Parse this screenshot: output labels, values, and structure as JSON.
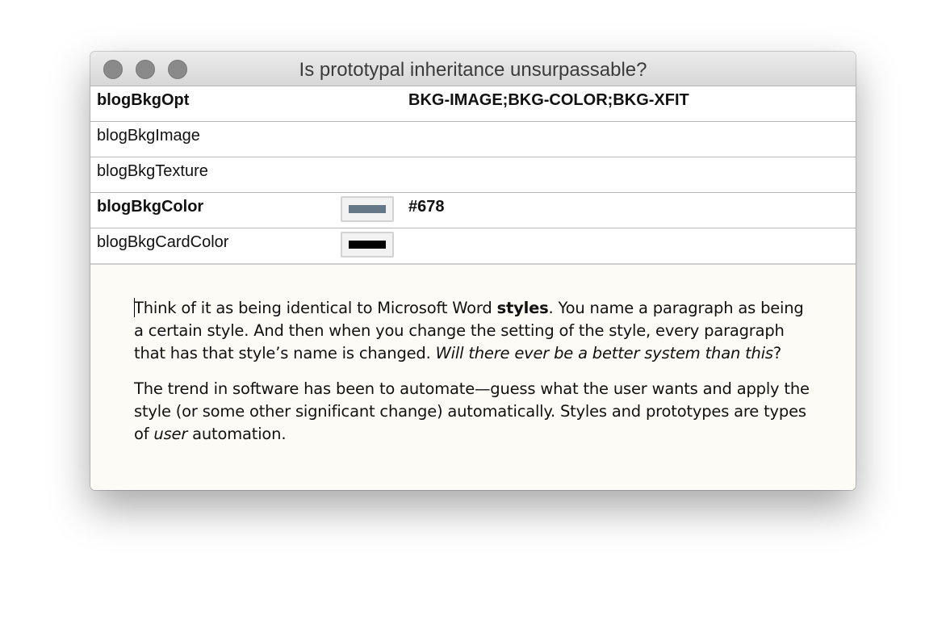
{
  "window": {
    "title": "Is prototypal inheritance unsurpassable?"
  },
  "settings": [
    {
      "key": "blogBkgOpt",
      "bold": true,
      "value": "BKG-IMAGE;BKG-COLOR;BKG-XFIT"
    },
    {
      "key": "blogBkgImage",
      "bold": false,
      "value": ""
    },
    {
      "key": "blogBkgTexture",
      "bold": false,
      "value": ""
    },
    {
      "key": "blogBkgColor",
      "bold": true,
      "value": "#678",
      "swatch_color": "#667788"
    },
    {
      "key": "blogBkgCardColor",
      "bold": false,
      "value": "",
      "swatch_color": "#000000"
    }
  ],
  "content": {
    "p1": {
      "a": "Think of it as being identical to Microsoft Word ",
      "b": "styles",
      "c": ". You name a paragraph as being a certain style. And then when you change the setting of the style, every paragraph that has that style’s name is changed. ",
      "d": "Will there ever be a better system than this",
      "e": "?"
    },
    "p2": {
      "a": "The trend in software has been to automate—guess what the user wants and apply the style (or some other significant change) automatically. Styles and prototypes are types of ",
      "b": "user",
      "c": " automation."
    }
  }
}
